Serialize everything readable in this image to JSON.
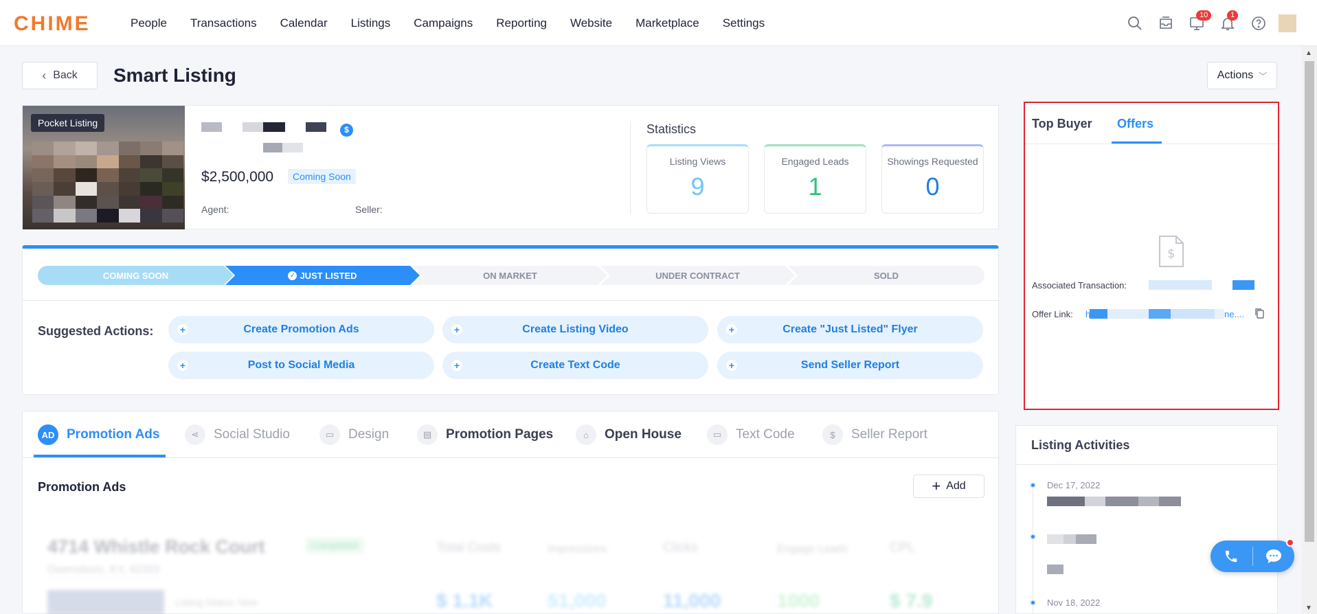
{
  "nav": {
    "logo": "CHIME",
    "items": [
      "People",
      "Transactions",
      "Calendar",
      "Listings",
      "Campaigns",
      "Reporting",
      "Website",
      "Marketplace",
      "Settings"
    ],
    "icons": [
      "search-icon",
      "inbox-icon",
      "tasks-icon",
      "bell-icon",
      "help-icon"
    ],
    "tasks_badge": "10",
    "bell_badge": "1"
  },
  "header": {
    "back_label": "Back",
    "title": "Smart Listing",
    "actions_label": "Actions"
  },
  "listing": {
    "tag": "Pocket Listing",
    "price": "$2,500,000",
    "status": "Coming Soon",
    "agent_label": "Agent:",
    "seller_label": "Seller:"
  },
  "statistics": {
    "title": "Statistics",
    "items": [
      {
        "label": "Listing Views",
        "value": "9",
        "color": "#6ec6f5"
      },
      {
        "label": "Engaged Leads",
        "value": "1",
        "color": "#2ec27e"
      },
      {
        "label": "Showings Requested",
        "value": "0",
        "color": "#1f7fe6"
      }
    ]
  },
  "stages": [
    "COMING SOON",
    "JUST LISTED",
    "ON MARKET",
    "UNDER CONTRACT",
    "SOLD"
  ],
  "suggested": {
    "label": "Suggested Actions:",
    "actions": [
      "Create Promotion Ads",
      "Create Listing Video",
      "Create \"Just Listed\" Flyer",
      "Post to Social Media",
      "Create Text Code",
      "Send Seller Report"
    ]
  },
  "tabs": [
    "Promotion Ads",
    "Social Studio",
    "Design",
    "Promotion Pages",
    "Open House",
    "Text Code",
    "Seller Report"
  ],
  "promotion": {
    "title": "Promotion Ads",
    "add_label": "Add",
    "row": {
      "address": "4714 Whistle Rock Court",
      "city": "Owensboro, KY, 42303",
      "status": "Completed",
      "headers": [
        "Total Costs",
        "Impressions",
        "Clicks",
        "Engage Leads",
        "CPL"
      ],
      "values": [
        "$ 1.1K",
        "51,000",
        "11,000",
        "1000",
        "$ 7.9"
      ],
      "listing_status": "Listing Status: New"
    }
  },
  "offers_panel": {
    "tab_top_buyer": "Top Buyer",
    "tab_offers": "Offers",
    "assoc_label": "Associated Transaction:",
    "offer_link_label": "Offer Link:",
    "offer_link_prefix": "h",
    "offer_link_suffix": "ne...."
  },
  "activities": {
    "title": "Listing Activities",
    "items": [
      {
        "date": "Dec 17, 2022"
      },
      {
        "date": ""
      },
      {
        "date": "Nov 18, 2022"
      }
    ]
  }
}
